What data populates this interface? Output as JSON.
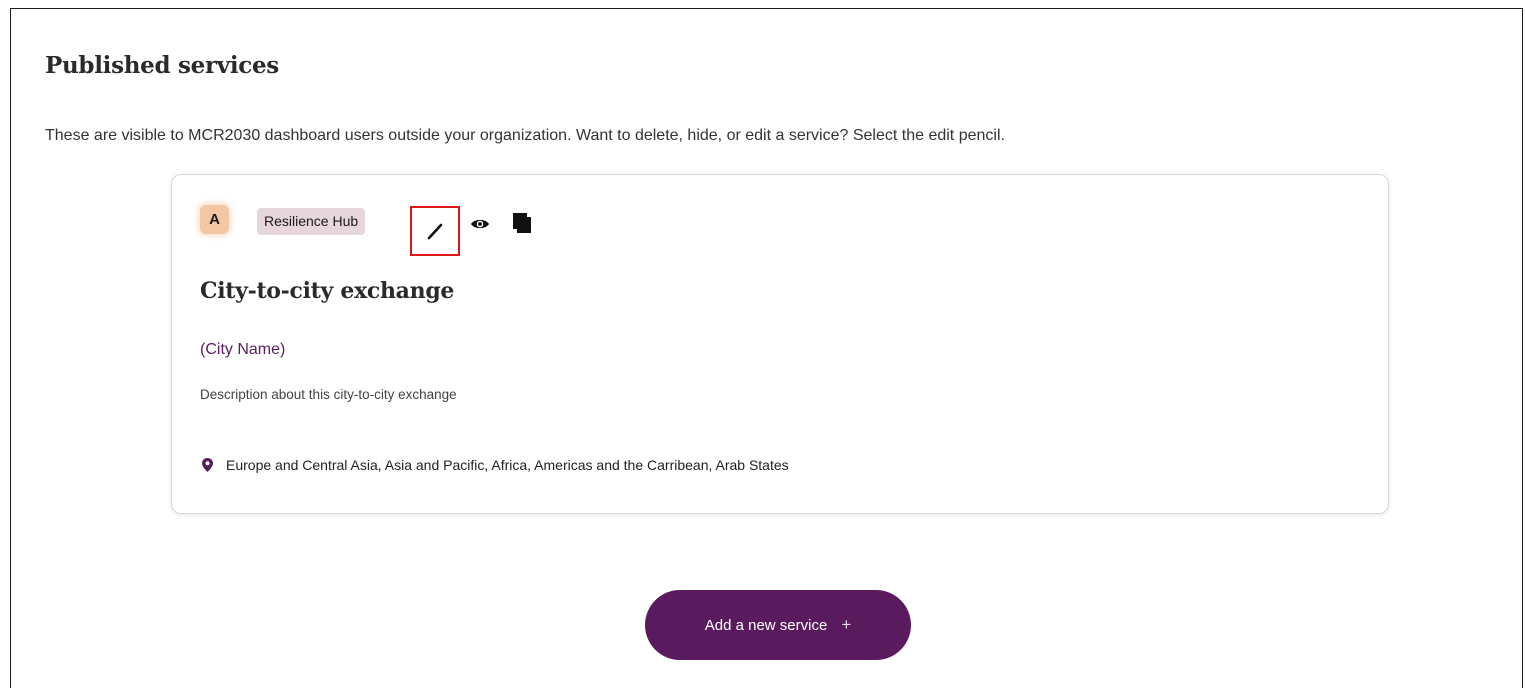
{
  "section": {
    "title": "Published services",
    "description": "These are visible to MCR2030 dashboard users outside your organization. Want to delete, hide, or edit a service? Select the edit pencil."
  },
  "service_card": {
    "avatar_letter": "A",
    "tag": "Resilience Hub",
    "actions": {
      "edit_icon": "pencil-icon",
      "view_icon": "eye-icon",
      "copy_icon": "copy-icon"
    },
    "title": "City-to-city exchange",
    "city": "(City Name)",
    "description": "Description about this city-to-city exchange",
    "regions": "Europe and Central Asia, Asia and Pacific, Africa, Americas and the Carribean, Arab States"
  },
  "add_button": {
    "label": "Add a new service",
    "icon": "+"
  },
  "colors": {
    "accent": "#5a1a5e",
    "highlight": "#e0141b",
    "avatar_bg": "#f3c7a4",
    "tag_bg": "#e7d7dc"
  }
}
